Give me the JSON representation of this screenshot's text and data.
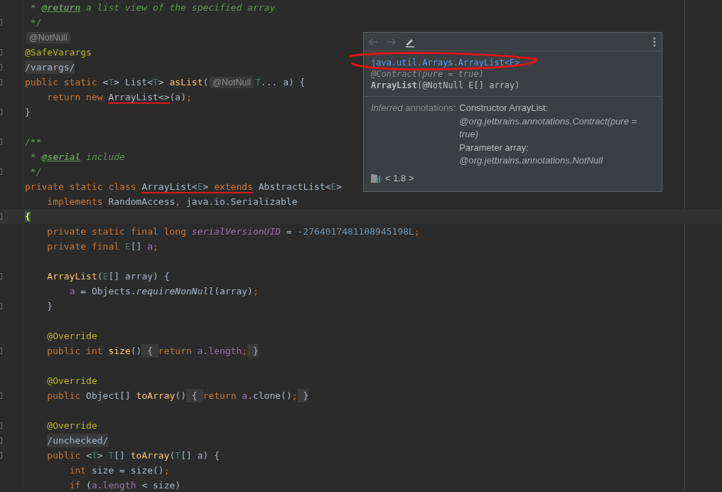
{
  "editor": {
    "lines": [
      {
        "fold_marker": false,
        "segments": [
          {
            "kind": "code",
            "tokens": [
              {
                "t": " * ",
                "kind": "doc"
              },
              {
                "t": "@return",
                "kind": "doctag"
              },
              {
                "t": " a list view of the specified array",
                "kind": "doc"
              }
            ]
          }
        ]
      },
      {
        "fold_marker": true,
        "segments": [
          {
            "kind": "code",
            "tokens": [
              {
                "t": " */",
                "kind": "doc"
              }
            ]
          }
        ]
      },
      {
        "fold_marker": false,
        "segments": [
          {
            "kind": "inlay",
            "text": "@NotNull"
          }
        ]
      },
      {
        "fold_marker": true,
        "segments": [
          {
            "kind": "code",
            "tokens": [
              {
                "t": "@SafeVarargs",
                "kind": "annotation"
              }
            ]
          }
        ]
      },
      {
        "fold_marker": true,
        "segments": [
          {
            "kind": "folded",
            "text": "/varargs/"
          }
        ]
      },
      {
        "fold_marker": true,
        "segments": [
          {
            "kind": "code",
            "tokens": [
              {
                "t": "public static ",
                "kind": "keyword"
              },
              {
                "t": "<",
                "kind": "plain"
              },
              {
                "t": "T",
                "kind": "typeparam"
              },
              {
                "t": "> List<",
                "kind": "plain"
              },
              {
                "t": "T",
                "kind": "typeparam"
              },
              {
                "t": "> ",
                "kind": "plain"
              },
              {
                "t": "asList",
                "kind": "method"
              },
              {
                "t": "(",
                "kind": "plain"
              }
            ]
          },
          {
            "kind": "inlay",
            "text": "@NotNull"
          },
          {
            "kind": "code",
            "tokens": [
              {
                "t": "T",
                "kind": "typeparam"
              },
              {
                "t": "... a) {",
                "kind": "plain"
              }
            ]
          }
        ]
      },
      {
        "fold_marker": false,
        "segments": [
          {
            "kind": "code",
            "tokens": [
              {
                "t": "    return new ",
                "kind": "keyword"
              },
              {
                "t": "ArrayList<>",
                "kind": "plain",
                "underlined": true
              },
              {
                "t": "(a)",
                "kind": "plain"
              },
              {
                "t": ";",
                "kind": "keyword"
              }
            ]
          }
        ]
      },
      {
        "fold_marker": true,
        "segments": [
          {
            "kind": "code",
            "tokens": [
              {
                "t": "}",
                "kind": "plain"
              }
            ]
          }
        ]
      },
      {
        "fold_marker": false
      },
      {
        "fold_marker": true,
        "segments": [
          {
            "kind": "code",
            "tokens": [
              {
                "t": "/**",
                "kind": "doc"
              }
            ]
          }
        ]
      },
      {
        "fold_marker": false,
        "segments": [
          {
            "kind": "code",
            "tokens": [
              {
                "t": " * ",
                "kind": "doc"
              },
              {
                "t": "@serial",
                "kind": "doctag"
              },
              {
                "t": " include",
                "kind": "doc"
              }
            ]
          }
        ]
      },
      {
        "fold_marker": true,
        "segments": [
          {
            "kind": "code",
            "tokens": [
              {
                "t": " */",
                "kind": "doc"
              }
            ]
          }
        ]
      },
      {
        "fold_marker": false,
        "segments": [
          {
            "kind": "code",
            "tokens": [
              {
                "t": "private static class ",
                "kind": "keyword"
              },
              {
                "t": "ArrayList<",
                "kind": "plain",
                "underlined": true
              },
              {
                "t": "E",
                "kind": "typeparam",
                "underlined": true
              },
              {
                "t": ">",
                "kind": "plain",
                "underlined": true
              },
              {
                "t": " extends",
                "kind": "keyword",
                "underlined": true
              },
              {
                "t": " AbstractList<",
                "kind": "plain"
              },
              {
                "t": "E",
                "kind": "typeparam"
              },
              {
                "t": ">",
                "kind": "plain"
              }
            ]
          }
        ]
      },
      {
        "fold_marker": false,
        "segments": [
          {
            "kind": "code",
            "tokens": [
              {
                "t": "    implements ",
                "kind": "keyword"
              },
              {
                "t": "RandomAccess",
                "kind": "plain"
              },
              {
                "t": ", ",
                "kind": "keyword"
              },
              {
                "t": "java.io.Serializable",
                "kind": "plain"
              }
            ]
          }
        ]
      },
      {
        "fold_marker": true,
        "current": true,
        "segments": [
          {
            "kind": "code",
            "tokens": [
              {
                "t": "{",
                "kind": "bracematch"
              }
            ]
          }
        ]
      },
      {
        "fold_marker": false,
        "segments": [
          {
            "kind": "code",
            "tokens": [
              {
                "t": "    private static final long ",
                "kind": "keyword"
              },
              {
                "t": "serialVersionUID",
                "kind": "staticfield"
              },
              {
                "t": " = ",
                "kind": "plain"
              },
              {
                "t": "-2764017481108945198L",
                "kind": "number"
              },
              {
                "t": ";",
                "kind": "keyword"
              }
            ]
          }
        ]
      },
      {
        "fold_marker": false,
        "segments": [
          {
            "kind": "code",
            "tokens": [
              {
                "t": "    private final ",
                "kind": "keyword"
              },
              {
                "t": "E",
                "kind": "typeparam"
              },
              {
                "t": "[] ",
                "kind": "plain"
              },
              {
                "t": "a",
                "kind": "field"
              },
              {
                "t": ";",
                "kind": "keyword"
              }
            ]
          }
        ]
      },
      {
        "fold_marker": false
      },
      {
        "fold_marker": true,
        "segments": [
          {
            "kind": "code",
            "tokens": [
              {
                "t": "    ArrayList",
                "kind": "method"
              },
              {
                "t": "(",
                "kind": "plain"
              },
              {
                "t": "E",
                "kind": "typeparam"
              },
              {
                "t": "[] array) {",
                "kind": "plain"
              }
            ]
          }
        ]
      },
      {
        "fold_marker": false,
        "segments": [
          {
            "kind": "code",
            "tokens": [
              {
                "t": "        a",
                "kind": "field"
              },
              {
                "t": " = Objects.",
                "kind": "plain"
              },
              {
                "t": "requireNonNull",
                "kind": "staticcall"
              },
              {
                "t": "(array)",
                "kind": "plain"
              },
              {
                "t": ";",
                "kind": "keyword"
              }
            ]
          }
        ]
      },
      {
        "fold_marker": true,
        "segments": [
          {
            "kind": "code",
            "tokens": [
              {
                "t": "    }",
                "kind": "plain"
              }
            ]
          }
        ]
      },
      {
        "fold_marker": false
      },
      {
        "fold_marker": false,
        "segments": [
          {
            "kind": "code",
            "tokens": [
              {
                "t": "    @Override",
                "kind": "annotation"
              }
            ]
          }
        ]
      },
      {
        "fold_marker": true,
        "segments": [
          {
            "kind": "code",
            "tokens": [
              {
                "t": "    public int ",
                "kind": "keyword"
              },
              {
                "t": "size",
                "kind": "method"
              },
              {
                "t": "()",
                "kind": "plain"
              }
            ]
          },
          {
            "kind": "folded",
            "text": " { "
          },
          {
            "kind": "code",
            "tokens": [
              {
                "t": "return ",
                "kind": "keyword"
              },
              {
                "t": "a",
                "kind": "field"
              },
              {
                "t": ".",
                "kind": "plain"
              },
              {
                "t": "length",
                "kind": "field"
              },
              {
                "t": ";",
                "kind": "keyword"
              }
            ]
          },
          {
            "kind": "folded",
            "text": " }"
          }
        ]
      },
      {
        "fold_marker": false
      },
      {
        "fold_marker": false,
        "segments": [
          {
            "kind": "code",
            "tokens": [
              {
                "t": "    @Override",
                "kind": "annotation"
              }
            ]
          }
        ]
      },
      {
        "fold_marker": true,
        "segments": [
          {
            "kind": "code",
            "tokens": [
              {
                "t": "    public ",
                "kind": "keyword"
              },
              {
                "t": "Object[] ",
                "kind": "plain"
              },
              {
                "t": "toArray",
                "kind": "method"
              },
              {
                "t": "()",
                "kind": "plain"
              }
            ]
          },
          {
            "kind": "folded",
            "text": " { "
          },
          {
            "kind": "code",
            "tokens": [
              {
                "t": "return ",
                "kind": "keyword"
              },
              {
                "t": "a",
                "kind": "field"
              },
              {
                "t": ".clone()",
                "kind": "plain"
              },
              {
                "t": ";",
                "kind": "keyword"
              }
            ]
          },
          {
            "kind": "folded",
            "text": " }"
          }
        ]
      },
      {
        "fold_marker": false
      },
      {
        "fold_marker": true,
        "segments": [
          {
            "kind": "code",
            "tokens": [
              {
                "t": "    @Override",
                "kind": "annotation"
              }
            ]
          }
        ]
      },
      {
        "fold_marker": true,
        "segments": [
          {
            "kind": "folded",
            "text": "    /unchecked/"
          }
        ]
      },
      {
        "fold_marker": true,
        "segments": [
          {
            "kind": "code",
            "tokens": [
              {
                "t": "    public ",
                "kind": "keyword"
              },
              {
                "t": "<",
                "kind": "plain"
              },
              {
                "t": "T",
                "kind": "typeparam"
              },
              {
                "t": "> ",
                "kind": "plain"
              },
              {
                "t": "T",
                "kind": "typeparam"
              },
              {
                "t": "[] ",
                "kind": "plain"
              },
              {
                "t": "toArray",
                "kind": "method"
              },
              {
                "t": "(",
                "kind": "plain"
              },
              {
                "t": "T",
                "kind": "typeparam"
              },
              {
                "t": "[] a) {",
                "kind": "plain"
              }
            ]
          }
        ]
      },
      {
        "fold_marker": false,
        "segments": [
          {
            "kind": "code",
            "tokens": [
              {
                "t": "        int ",
                "kind": "keyword"
              },
              {
                "t": "size = size()",
                "kind": "plain"
              },
              {
                "t": ";",
                "kind": "keyword"
              }
            ]
          }
        ]
      },
      {
        "fold_marker": false,
        "segments": [
          {
            "kind": "code",
            "tokens": [
              {
                "t": "        if ",
                "kind": "keyword"
              },
              {
                "t": "(",
                "kind": "plain"
              },
              {
                "t": "a",
                "kind": "field"
              },
              {
                "t": ".",
                "kind": "plain"
              },
              {
                "t": "length",
                "kind": "field"
              },
              {
                "t": " < size)",
                "kind": "plain"
              }
            ]
          }
        ]
      }
    ]
  },
  "popup": {
    "toolbar": [
      {
        "kind": "back",
        "disabled": true
      },
      {
        "kind": "forward",
        "disabled": true
      },
      {
        "kind": "edit",
        "disabled": false
      }
    ],
    "link": "java.util.Arrays.ArrayList<E>",
    "link_circled": true,
    "signature": [
      {
        "kind": "annotation",
        "text": "@Contract(pure = true)"
      },
      {
        "kind": "declaration",
        "name": "ArrayList",
        "params": "(@NotNull E[] array)"
      }
    ],
    "sections": [
      {
        "label": "*Inferred* annotations:",
        "entries": [
          {
            "kind": "heading",
            "text": "Constructor ArrayList:"
          },
          {
            "kind": "annotation",
            "text": "@org.jetbrains.annotations.Contract(pure = true)"
          },
          {
            "kind": "heading",
            "text": "Parameter array:"
          },
          {
            "kind": "annotation",
            "text": "@org.jetbrains.annotations.NotNull"
          }
        ]
      }
    ],
    "footer": "< 1.8 >"
  }
}
